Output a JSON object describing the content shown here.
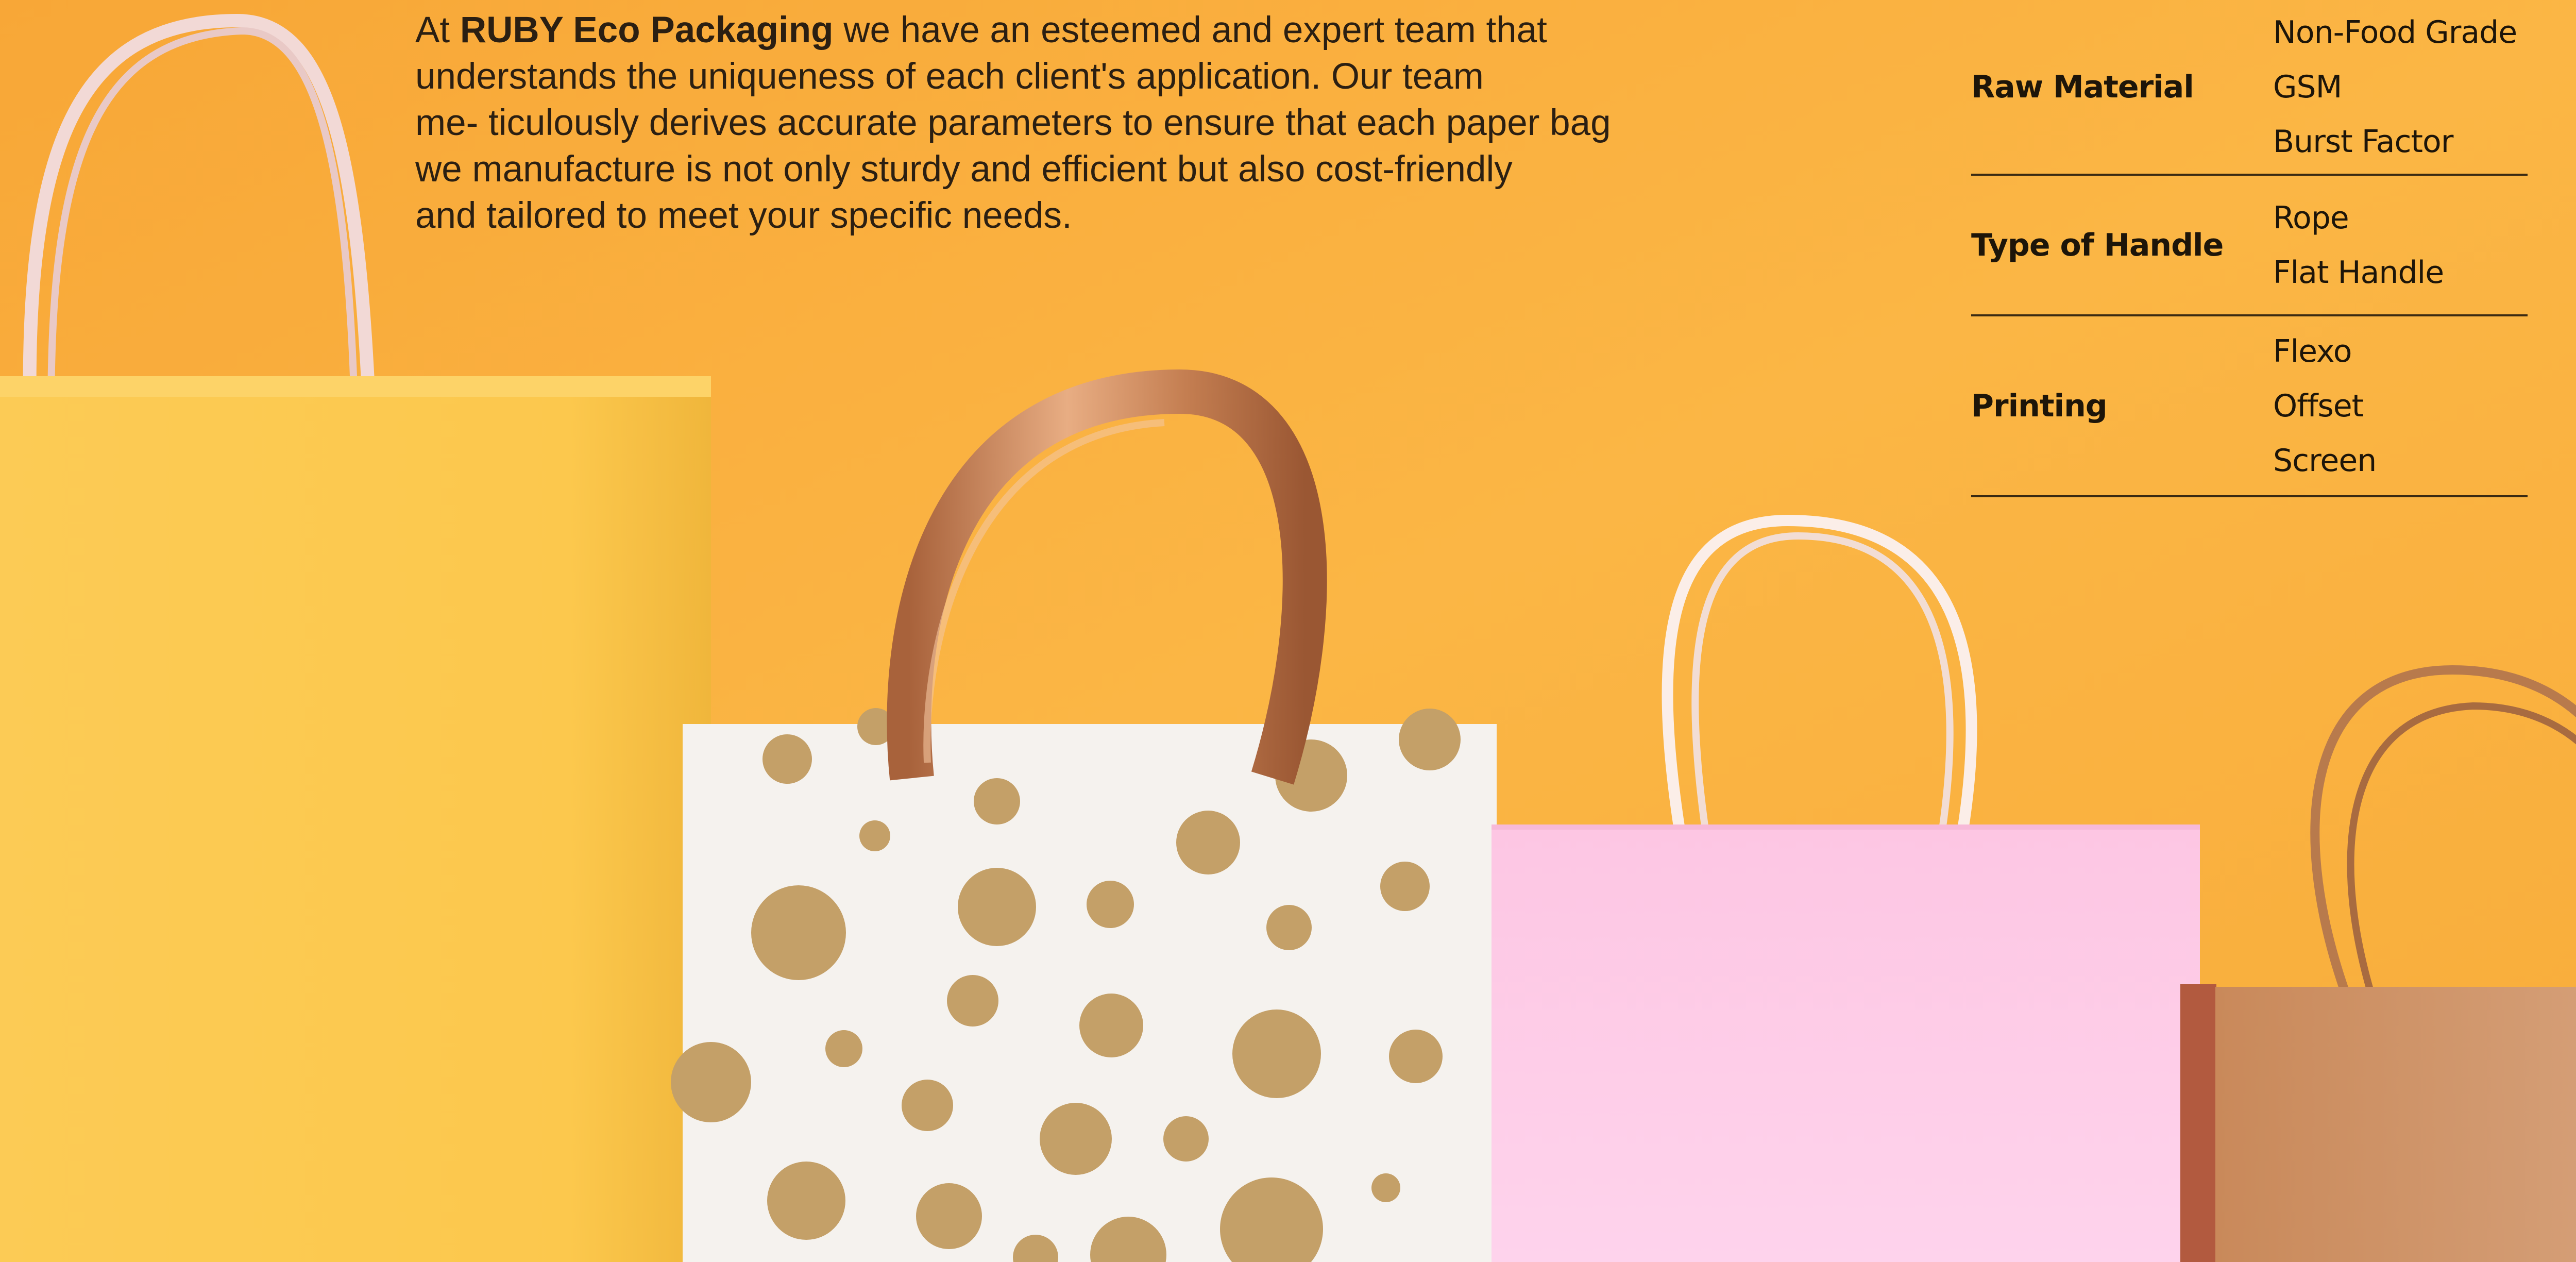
{
  "intro": {
    "prefix": "At ",
    "brand": "RUBY Eco Packaging",
    "line1_rest": " we have an esteemed and expert team that",
    "line2": "understands the uniqueness of each client's application. Our team",
    "line3": "me- ticulously derives accurate parameters to ensure that each paper bag",
    "line4": "we manufacture is not only sturdy and efficient but also cost-friendly",
    "line5": "and tailored to meet your specific needs."
  },
  "specs": [
    {
      "label": "Raw Material",
      "values": [
        "Non-Food Grade",
        "GSM",
        "Burst Factor"
      ]
    },
    {
      "label": "Type of Handle",
      "values": [
        "Rope",
        "Flat Handle"
      ]
    },
    {
      "label": "Printing",
      "values": [
        "Flexo",
        "Offset",
        "Screen"
      ]
    }
  ],
  "colors": {
    "background": "#f9ad3c",
    "yellow_bag": "#fcc64a",
    "polka_bag": "#f4f1ec",
    "polka_dots": "#c6a168",
    "pink_bag": "#fdc9e6",
    "kraft_bag": "#c98f5e"
  }
}
